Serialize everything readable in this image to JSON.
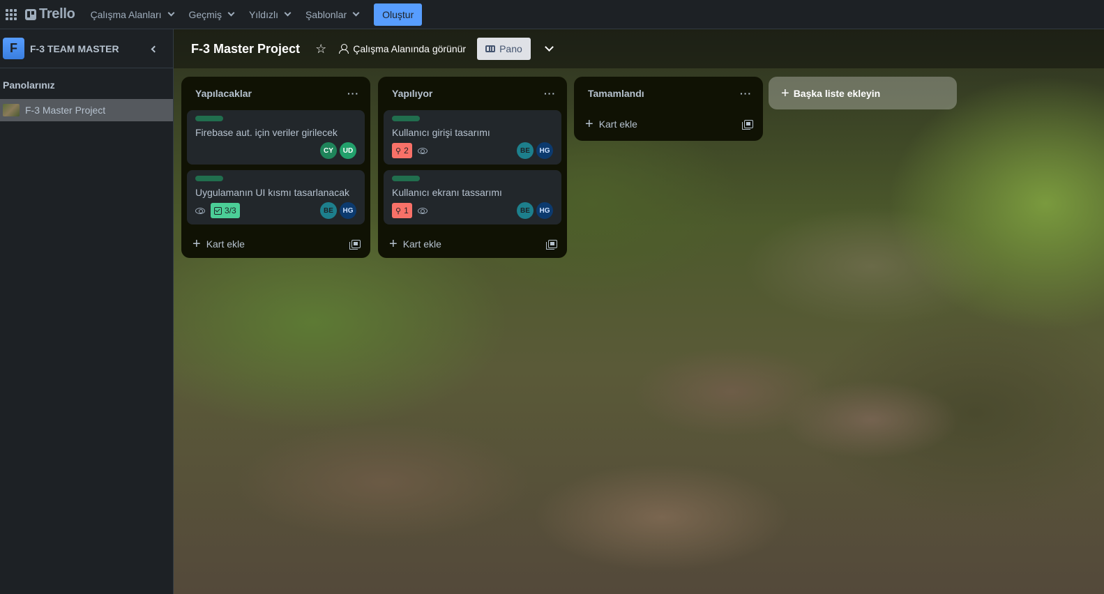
{
  "topbar": {
    "logo": "Trello",
    "nav": [
      "Çalışma Alanları",
      "Geçmiş",
      "Yıldızlı",
      "Şablonlar"
    ],
    "create_label": "Oluştur"
  },
  "sidebar": {
    "workspace_initial": "F",
    "workspace_name": "F-3 TEAM MASTER",
    "boards_title": "Panolarınız",
    "boards": [
      {
        "label": "F-3 Master Project"
      }
    ]
  },
  "board": {
    "title": "F-3 Master Project",
    "visibility": "Çalışma Alanında görünür",
    "view_label": "Pano",
    "add_list_label": "Başka liste ekleyin",
    "lists": [
      {
        "title": "Yapılacaklar",
        "menu": "···",
        "add_card_label": "Kart ekle",
        "cards": [
          {
            "title": "Firebase aut. için veriler girilecek",
            "members": [
              "CY",
              "UD"
            ]
          },
          {
            "title": "Uygulamanın UI kısmı tasarlanacak",
            "checklist": "3/3",
            "members": [
              "BE",
              "HG"
            ]
          }
        ]
      },
      {
        "title": "Yapılıyor",
        "menu": "···",
        "add_card_label": "Kart ekle",
        "cards": [
          {
            "title": "Kullanıcı girişi tasarımı",
            "attachments": "2",
            "members": [
              "BE",
              "HG"
            ]
          },
          {
            "title": "Kullanıcı ekranı tassarımı",
            "attachments": "1",
            "members": [
              "BE",
              "HG"
            ]
          }
        ]
      },
      {
        "title": "Tamamlandı",
        "menu": "···",
        "add_card_label": "Kart ekle",
        "cards": []
      }
    ]
  },
  "colors": {
    "accent": "#579dff",
    "label_green": "#216e4e",
    "avatar_cy": "#1f845a",
    "avatar_ud": "#1f845a",
    "avatar_be": "#1d7f8c",
    "avatar_hg": "#0c3a6e"
  }
}
